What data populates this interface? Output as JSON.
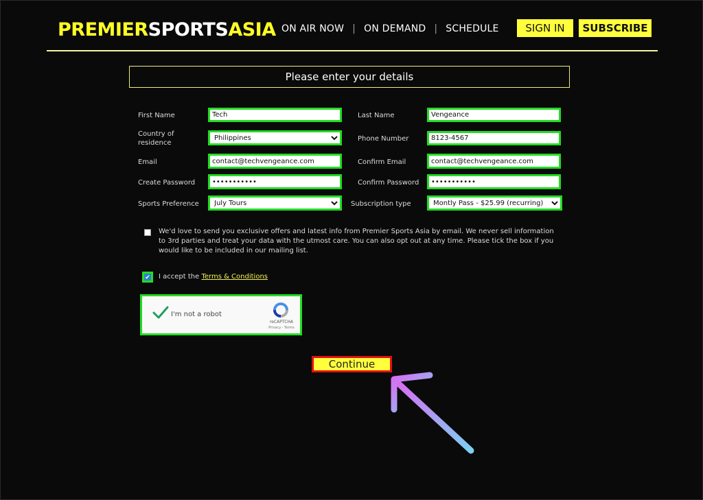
{
  "header": {
    "logo": {
      "part1": "PREMIER",
      "part2": "SPORTS",
      "part3": "ASIA"
    },
    "nav": [
      "ON AIR NOW",
      "ON DEMAND",
      "SCHEDULE"
    ],
    "sign_in": "SIGN IN",
    "subscribe": "SUBSCRIBE"
  },
  "form": {
    "title": "Please enter your details",
    "first_name": {
      "label": "First Name",
      "value": "Tech"
    },
    "last_name": {
      "label": "Last Name",
      "value": "Vengeance"
    },
    "country": {
      "label": "Country of residence",
      "value": "Philippines"
    },
    "phone": {
      "label": "Phone Number",
      "value": "8123-4567"
    },
    "email": {
      "label": "Email",
      "value": "contact@techvengeance.com"
    },
    "confirm_email": {
      "label": "Confirm Email",
      "value": "contact@techvengeance.com"
    },
    "password": {
      "label": "Create Password",
      "value": "•••••••••••"
    },
    "confirm_password": {
      "label": "Confirm Password",
      "value": "•••••••••••"
    },
    "sports_pref": {
      "label": "Sports Preference",
      "value": "July Tours"
    },
    "subscription": {
      "label": "Subscription type",
      "value": "Montly Pass - $25.99 (recurring)"
    },
    "marketing_text": "We'd love to send you exclusive offers and latest info from Premier Sports Asia by email. We never sell information to 3rd parties and treat your data with the utmost care. You can also opt out at any time. Please tick the box if you would like to be included in our mailing list.",
    "accept_prefix": "I accept the",
    "terms_link": "Terms & Conditions",
    "continue": "Continue"
  },
  "captcha": {
    "label": "I'm not a robot",
    "brand": "reCAPTCHA",
    "links": "Privacy - Terms"
  },
  "colors": {
    "accent_yellow": "#ffff3c",
    "highlight_green": "#22dd22",
    "highlight_red": "#e01010"
  }
}
